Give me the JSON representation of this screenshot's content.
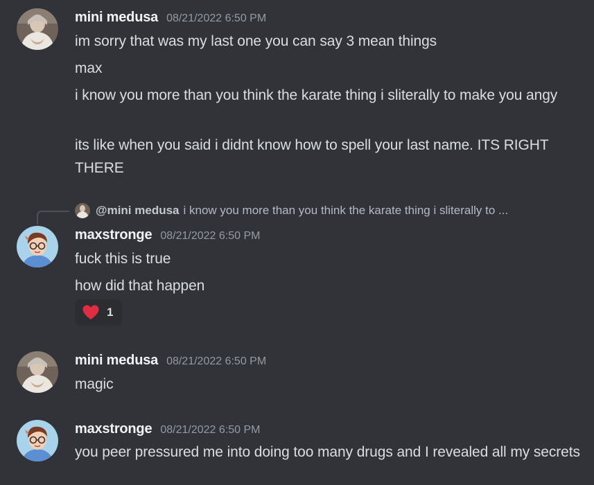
{
  "messages": [
    {
      "author": "mini medusa",
      "timestamp": "08/21/2022 6:50 PM",
      "avatar_icon": "photo-avatar",
      "lines": [
        "im sorry that was my last one you can say 3 mean things",
        "max",
        "i know you more than you think the karate thing i sliterally to make you angy",
        "its like when you said i didnt know how to spell your last name. ITS RIGHT THERE"
      ]
    },
    {
      "author": "maxstronge",
      "timestamp": "08/21/2022 6:50 PM",
      "avatar_icon": "cartoon-avatar",
      "reply": {
        "mention": "@mini medusa",
        "preview": "i know you more than you think the karate thing i sliterally to ..."
      },
      "lines": [
        "fuck this is true",
        "how did that happen"
      ],
      "reaction": {
        "icon": "red-heart-icon",
        "count": "1"
      }
    },
    {
      "author": "mini medusa",
      "timestamp": "08/21/2022 6:50 PM",
      "avatar_icon": "photo-avatar",
      "lines": [
        "magic"
      ]
    },
    {
      "author": "maxstronge",
      "timestamp": "08/21/2022 6:50 PM",
      "avatar_icon": "cartoon-avatar",
      "lines": [
        "you peer pressured me into doing too many drugs and I revealed all my secrets"
      ]
    }
  ],
  "colors": {
    "background": "#313338",
    "username": "#f2f3f5",
    "timestamp": "#949ba4",
    "text": "#dbdee1",
    "reaction_bg": "#2b2d31",
    "heart": "#dd2e44"
  }
}
